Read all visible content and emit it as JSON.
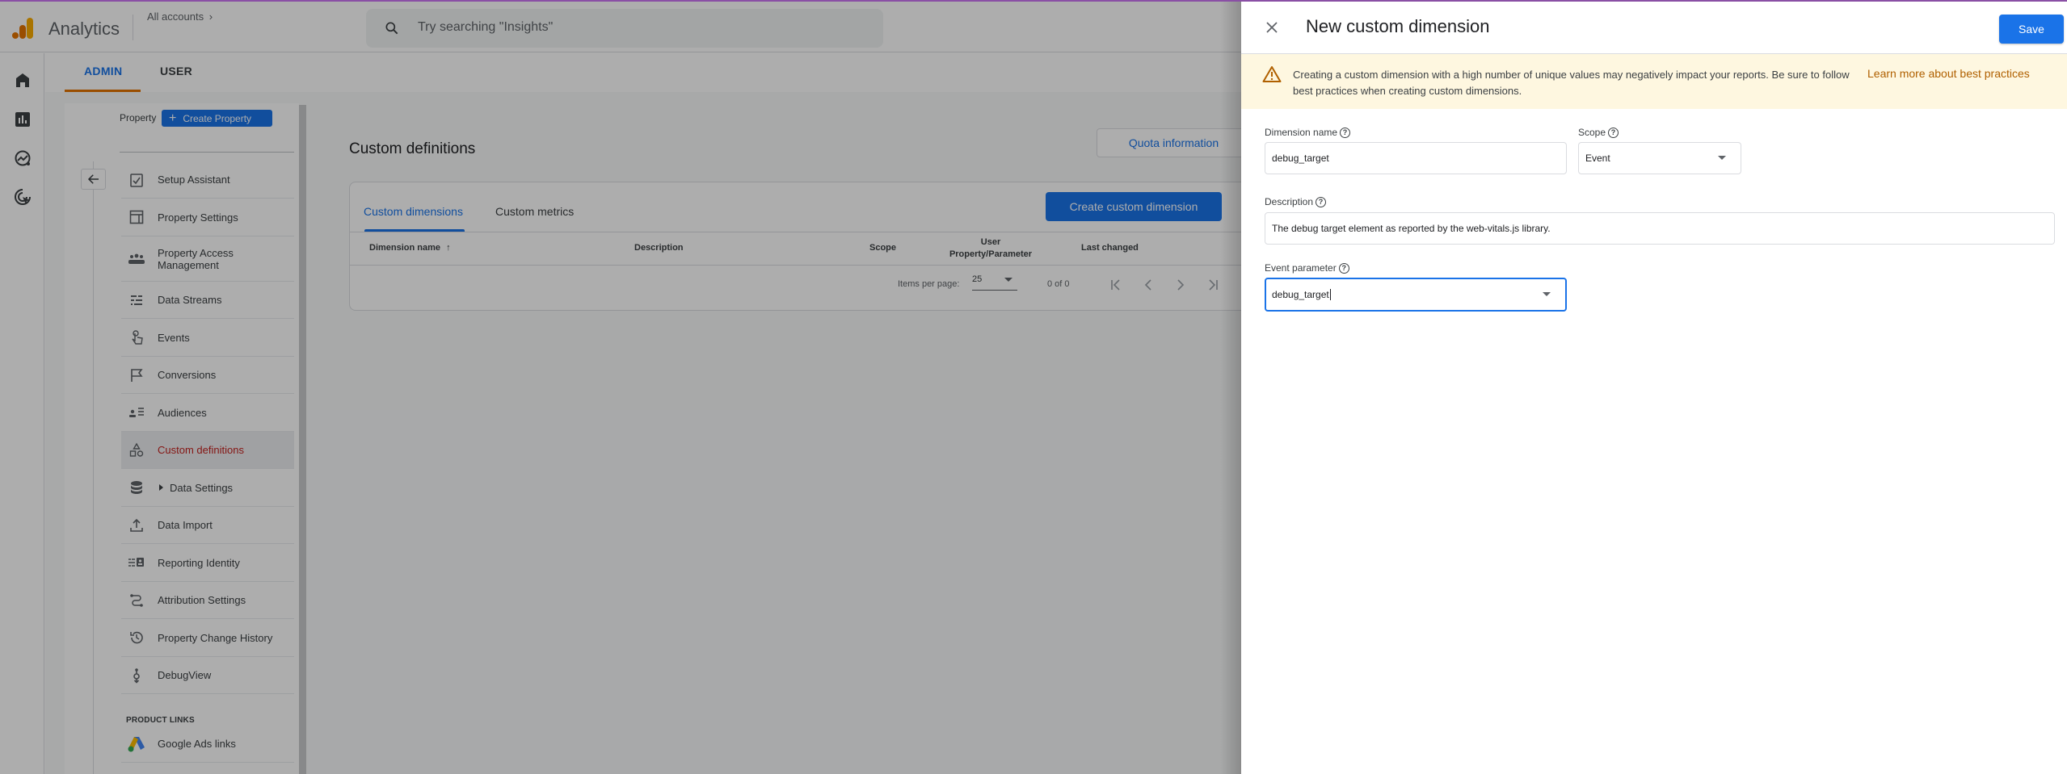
{
  "header": {
    "app_title": "Analytics",
    "breadcrumb": "All accounts",
    "search_placeholder": "Try searching \"Insights\""
  },
  "rail": {
    "items": [
      {
        "icon": "home-icon",
        "label": "Home"
      },
      {
        "icon": "reports-icon",
        "label": "Reports"
      },
      {
        "icon": "explore-icon",
        "label": "Explore"
      },
      {
        "icon": "advertising-icon",
        "label": "Advertising"
      }
    ]
  },
  "admin_tabs": [
    {
      "label": "ADMIN",
      "active": true
    },
    {
      "label": "USER",
      "active": false
    }
  ],
  "nav": {
    "property_label": "Property",
    "create_property_label": "Create Property",
    "items": [
      {
        "label": "Setup Assistant",
        "icon": "setup-assistant-icon"
      },
      {
        "label": "Property Settings",
        "icon": "property-settings-icon"
      },
      {
        "label": "Property Access Management",
        "icon": "people-icon"
      },
      {
        "label": "Data Streams",
        "icon": "data-streams-icon"
      },
      {
        "label": "Events",
        "icon": "touch-icon"
      },
      {
        "label": "Conversions",
        "icon": "flag-icon"
      },
      {
        "label": "Audiences",
        "icon": "audiences-icon"
      },
      {
        "label": "Custom definitions",
        "icon": "shapes-icon",
        "active": true
      },
      {
        "label": "Data Settings",
        "icon": "database-icon",
        "expandable": true
      },
      {
        "label": "Data Import",
        "icon": "upload-icon"
      },
      {
        "label": "Reporting Identity",
        "icon": "reporting-identity-icon"
      },
      {
        "label": "Attribution Settings",
        "icon": "attribution-icon"
      },
      {
        "label": "Property Change History",
        "icon": "history-icon"
      },
      {
        "label": "DebugView",
        "icon": "debug-icon"
      }
    ],
    "product_links_heading": "PRODUCT LINKS",
    "product_links": [
      {
        "label": "Google Ads links",
        "icon": "google-ads-icon"
      }
    ]
  },
  "main": {
    "title": "Custom definitions",
    "quota_button": "Quota information",
    "tabs": [
      {
        "label": "Custom dimensions",
        "active": true
      },
      {
        "label": "Custom metrics",
        "active": false
      }
    ],
    "create_button": "Create custom dimension",
    "columns": [
      "Dimension name",
      "Description",
      "Scope",
      "User Property/Parameter",
      "Last changed"
    ],
    "rows": [],
    "pagination": {
      "items_per_page_label": "Items per page:",
      "items_per_page": "25",
      "range": "0 of 0"
    }
  },
  "drawer": {
    "title": "New custom dimension",
    "save_label": "Save",
    "warning_text": "Creating a custom dimension with a high number of unique values may negatively impact your reports. Be sure to follow best practices when creating custom dimensions.",
    "warning_link": "Learn more about best practices",
    "fields": {
      "dimension_name": {
        "label": "Dimension name",
        "value": "debug_target"
      },
      "scope": {
        "label": "Scope",
        "value": "Event"
      },
      "description": {
        "label": "Description",
        "value": "The debug target element as reported by the web-vitals.js library."
      },
      "event_parameter": {
        "label": "Event parameter",
        "value": "debug_target"
      }
    }
  },
  "colors": {
    "accent": "#1a73e8",
    "admin_tab_indicator": "#e37400",
    "active_nav_text": "#c5221f",
    "warning_bg": "#fef7e0",
    "warning_link": "#b06000"
  }
}
